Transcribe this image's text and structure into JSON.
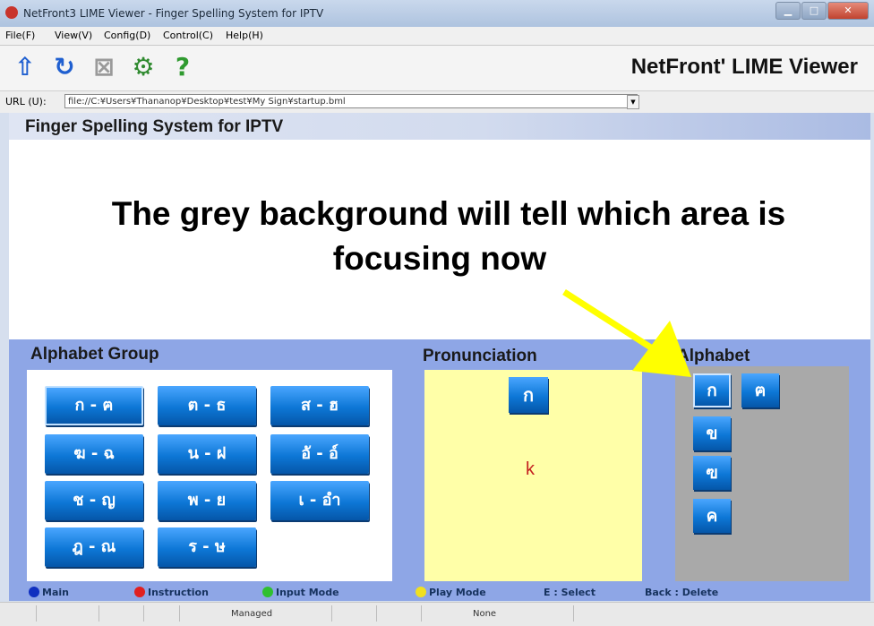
{
  "window": {
    "title": "NetFront3 LIME Viewer - Finger Spelling System for IPTV"
  },
  "menu": [
    "File(F)",
    "View(V)",
    "Config(D)",
    "Control(C)",
    "Help(H)"
  ],
  "toolbar": {
    "buttons": [
      {
        "icon": "up-arrow-icon",
        "glyph": "⇧",
        "color": "#1f5fd0"
      },
      {
        "icon": "reload-icon",
        "glyph": "↻",
        "color": "#1f5fd0"
      },
      {
        "icon": "stop-icon",
        "glyph": "⊠",
        "color": "#9a9a9a"
      },
      {
        "icon": "settings-icon",
        "glyph": "⚙",
        "color": "#2f8a2f"
      },
      {
        "icon": "help-icon",
        "glyph": "?",
        "color": "#2f9a2f"
      }
    ],
    "brand": "NetFront' LIME Viewer"
  },
  "url": {
    "label": "URL (U):",
    "value": "file://C:¥Users¥Thananop¥Desktop¥test¥My Sign¥startup.bml"
  },
  "page": {
    "header": "Finger Spelling System for IPTV",
    "annotation_line1": "The grey background will tell which area  is",
    "annotation_line2": "focusing now",
    "arrow_color": "#ffff00"
  },
  "alphabet_group": {
    "title": "Alphabet Group",
    "buttons": [
      "ก - ฅ",
      "ต - ธ",
      "ส - ฮ",
      "ฆ - ฉ",
      "น - ฝ",
      "อั - อ์",
      "ช - ญ",
      "พ - ย",
      "เ - อำ",
      "ฎ - ณ",
      "ร - ษ"
    ]
  },
  "pronunciation": {
    "title": "Pronunciation",
    "letter": "ก",
    "text": "k"
  },
  "alphabet": {
    "title": "Alphabet",
    "letters": [
      "ก",
      "ฅ",
      "ข",
      "ฃ",
      "ค"
    ]
  },
  "legend": {
    "main": "Main",
    "main_color": "#1030c0",
    "instruction": "Instruction",
    "instruction_color": "#e02020",
    "input_mode": "Input Mode",
    "input_mode_color": "#30c030",
    "play_mode": "Play Mode",
    "play_mode_color": "#f0e020",
    "select": "E : Select",
    "delete": "Back : Delete"
  },
  "status": {
    "managed": "Managed",
    "none": "None"
  },
  "colors": {
    "panel_blue": "#8ea6e6",
    "focus_grey": "#a9a9a9",
    "pron_yellow": "#ffffa8"
  }
}
